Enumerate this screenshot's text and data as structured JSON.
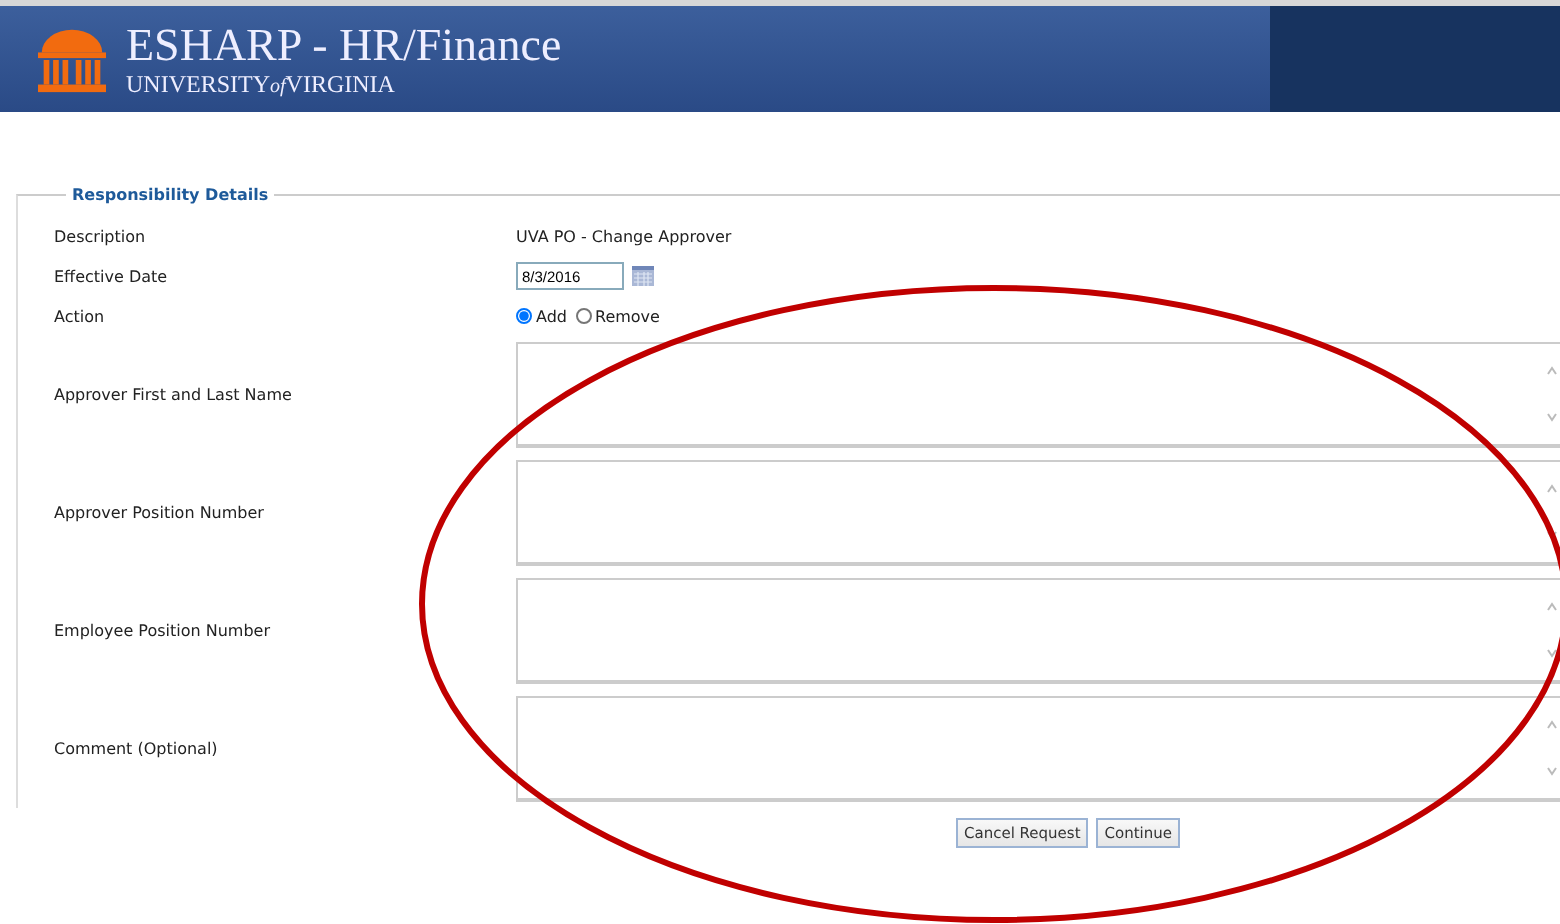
{
  "header": {
    "title": "ESHARP - HR/Finance",
    "subtitle_parts": [
      "UNIVERSITY",
      "of",
      "VIRGINIA"
    ]
  },
  "section": {
    "legend": "Responsibility Details",
    "description": {
      "label": "Description",
      "value": "UVA PO - Change Approver"
    },
    "effective_date": {
      "label": "Effective Date",
      "value": "8/3/2016"
    },
    "action": {
      "label": "Action",
      "options": [
        {
          "label": "Add",
          "selected": true
        },
        {
          "label": "Remove",
          "selected": false
        }
      ]
    },
    "text_areas": [
      {
        "label": "Approver First and Last Name"
      },
      {
        "label": "Approver Position Number"
      },
      {
        "label": "Employee Position Number"
      },
      {
        "label": "Comment (Optional)"
      }
    ]
  },
  "buttons": [
    "Cancel Request",
    "Continue"
  ],
  "annotation": {
    "kind": "ellipse",
    "color": "#c00000"
  }
}
